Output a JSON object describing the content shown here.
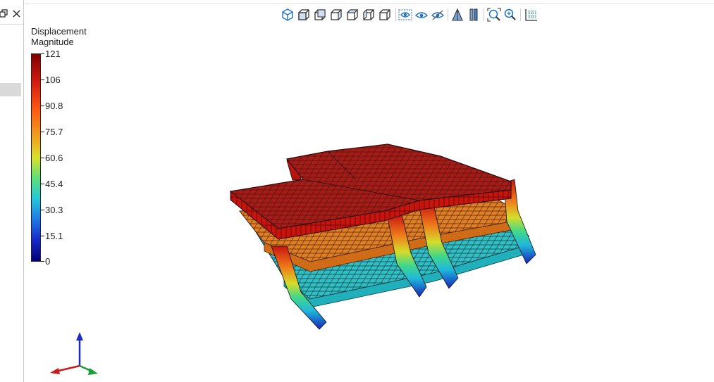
{
  "left_panel": {
    "tabs": [
      {
        "icon": "restore-window-icon"
      },
      {
        "icon": "close-icon"
      }
    ]
  },
  "toolbar": {
    "icons": [
      "iso-view-icon",
      "front-view-icon",
      "back-view-icon",
      "left-view-icon",
      "right-view-icon",
      "top-view-icon",
      "bottom-view-icon",
      "visibility-toggle-icon",
      "show-icon",
      "hide-icon",
      "perspective-icon",
      "section-icon",
      "zoom-fit-icon",
      "zoom-icon",
      "grid-icon"
    ]
  },
  "legend": {
    "title_line1": "Displacement",
    "title_line2": "Magnitude",
    "labels": [
      "121",
      "106",
      "90.8",
      "75.7",
      "60.6",
      "45.4",
      "30.3",
      "15.1",
      "0"
    ]
  },
  "colors": {
    "high": "#b01010",
    "mid_high": "#e07a1e",
    "mid": "#5ce07a",
    "mid_low": "#27c4cc",
    "low": "#1628c8"
  }
}
